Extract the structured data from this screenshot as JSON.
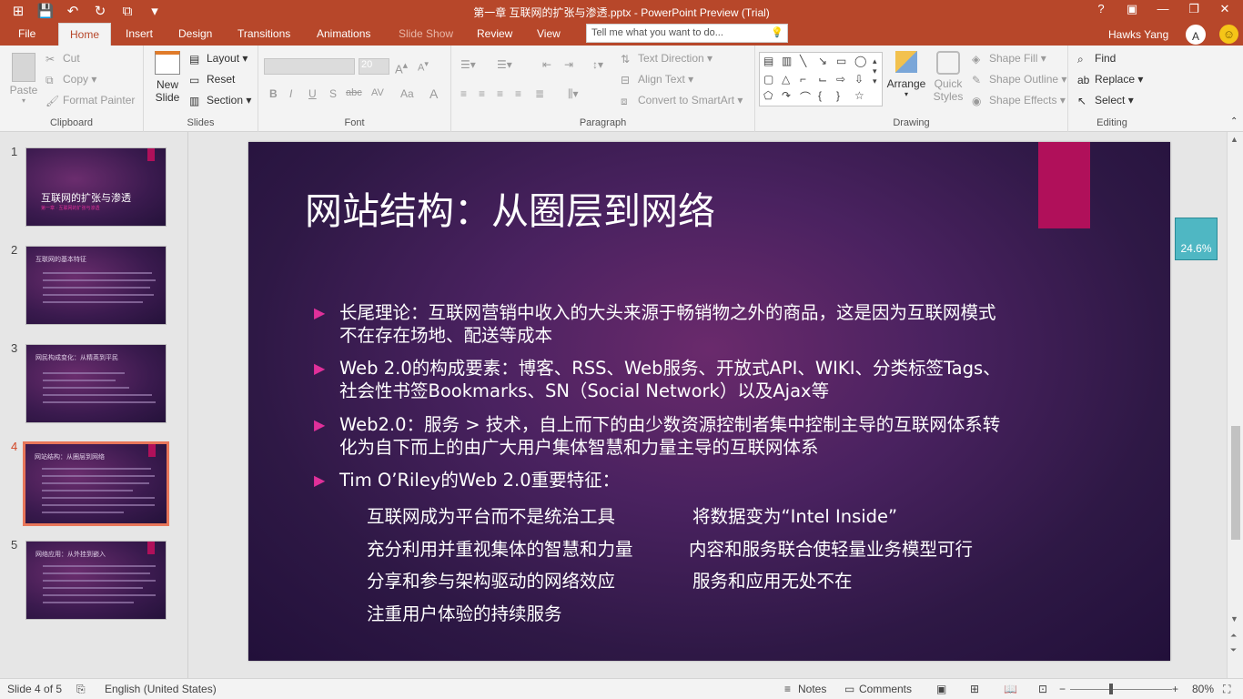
{
  "window": {
    "title": "第一章 互联网的扩张与渗透.pptx - PowerPoint Preview (Trial)",
    "controls": [
      "?",
      "▣",
      "—",
      "❐",
      "✕"
    ]
  },
  "quick_access": [
    "save-icon",
    "undo-icon",
    "redo-icon",
    "present-icon",
    "customize-icon"
  ],
  "tabs": [
    "File",
    "Home",
    "Insert",
    "Design",
    "Transitions",
    "Animations",
    "Slide Show",
    "Review",
    "View"
  ],
  "active_tab": "Home",
  "tell_me": {
    "placeholder": "Tell me what you want to do..."
  },
  "user": {
    "name": "Hawks Yang"
  },
  "ribbon": {
    "clipboard": {
      "label": "Clipboard",
      "paste": "Paste",
      "cut": "Cut",
      "copy": "Copy",
      "format_painter": "Format Painter"
    },
    "slides": {
      "label": "Slides",
      "new_slide": "New Slide",
      "layout": "Layout",
      "reset": "Reset",
      "section": "Section"
    },
    "font": {
      "label": "Font",
      "size": "20",
      "buttons": [
        "B",
        "I",
        "U",
        "S",
        "abc",
        "AV",
        "Aa",
        "A"
      ]
    },
    "paragraph": {
      "label": "Paragraph",
      "text_direction": "Text Direction",
      "align_text": "Align Text",
      "smartart": "Convert to SmartArt"
    },
    "drawing": {
      "label": "Drawing",
      "arrange": "Arrange",
      "quick_styles": "Quick Styles",
      "shape_fill": "Shape Fill",
      "shape_outline": "Shape Outline",
      "shape_effects": "Shape Effects"
    },
    "editing": {
      "label": "Editing",
      "find": "Find",
      "replace": "Replace",
      "select": "Select"
    }
  },
  "thumbnails": [
    {
      "num": "1",
      "title": "互联网的扩张与渗透",
      "subtitle": "第一章 · 互联网的扩张与渗透"
    },
    {
      "num": "2",
      "title": "互联网的基本特征"
    },
    {
      "num": "3",
      "title": "网民构成变化：从精英到平民"
    },
    {
      "num": "4",
      "title": "网站结构：从圈层到网络"
    },
    {
      "num": "5",
      "title": "网络应用：从外挂到嵌入"
    }
  ],
  "selected_slide": 4,
  "slide": {
    "title": "网站结构：从圈层到网络",
    "bullets": [
      "长尾理论：互联网营销中收入的大头来源于畅销物之外的商品，这是因为互联网模式不在存在场地、配送等成本",
      "Web 2.0的构成要素：博客、RSS、Web服务、开放式API、WIKI、分类标签Tags、社会性书签Bookmarks、SN（Social Network）以及Ajax等",
      "Web2.0：服务 > 技术，自上而下的由少数资源控制者集中控制主导的互联网体系转化为自下而上的由广大用户集体智慧和力量主导的互联网体系",
      "Tim O’Riley的Web 2.0重要特征："
    ],
    "features_left": [
      "互联网成为平台而不是统治工具",
      "充分利用并重视集体的智慧和力量",
      "分享和参与架构驱动的网络效应",
      "注重用户体验的持续服务"
    ],
    "features_right": [
      "将数据变为“Intel Inside”",
      "内容和服务联合使轻量业务模型可行",
      "服务和应用无处不在"
    ]
  },
  "zoom_bubble": "24.6%",
  "status": {
    "slide_of": "Slide 4 of 5",
    "language": "English (United States)",
    "notes": "Notes",
    "comments": "Comments",
    "zoom": "80%"
  },
  "colors": {
    "accent": "#b7472a",
    "slide_accent": "#b0105a",
    "bullet": "#e0309a"
  }
}
